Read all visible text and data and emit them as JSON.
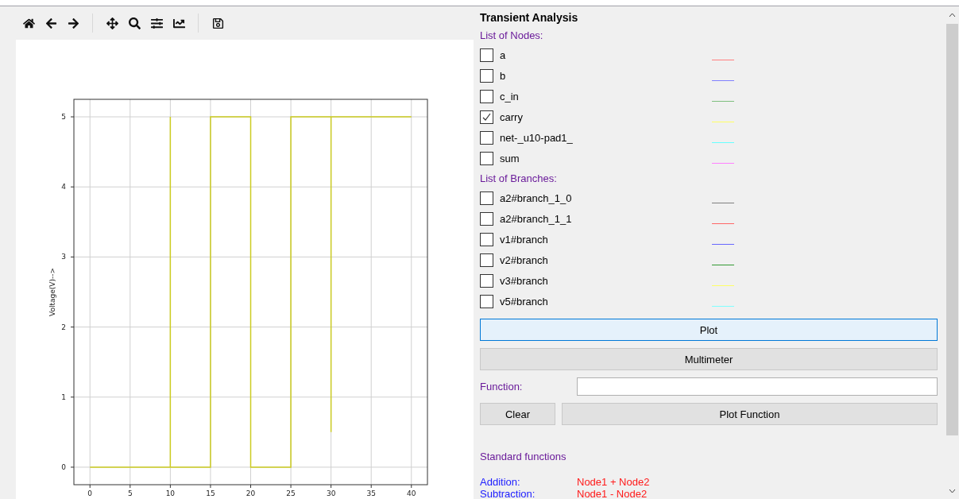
{
  "plot": {
    "chart_data": {
      "type": "line",
      "grid": true,
      "ylabel": "Voltage(V)-->",
      "xlim": [
        -2,
        42
      ],
      "ylim": [
        -0.25,
        5.25
      ],
      "xticks": [
        0,
        5,
        10,
        15,
        20,
        25,
        30,
        35,
        40
      ],
      "yticks": [
        0,
        1,
        2,
        3,
        4,
        5
      ],
      "x": [
        0,
        10,
        10,
        10,
        15,
        15,
        20,
        20,
        25,
        25,
        30,
        30,
        30,
        40
      ],
      "series": [
        {
          "color": "#cccc22",
          "values": [
            0,
            0,
            5,
            0,
            0,
            5,
            5,
            0,
            0,
            5,
            5,
            0.5,
            5,
            5
          ]
        }
      ]
    }
  },
  "panel": {
    "title": "Transient Analysis",
    "nodes_heading": "List of Nodes:",
    "nodes": [
      {
        "label": "a",
        "checked": false,
        "color": "#ff7f7f"
      },
      {
        "label": "b",
        "checked": false,
        "color": "#8080ff"
      },
      {
        "label": "c_in",
        "checked": false,
        "color": "#7fbf7f"
      },
      {
        "label": "carry",
        "checked": true,
        "color": "#ffff66"
      },
      {
        "label": "net-_u10-pad1_",
        "checked": false,
        "color": "#66ffff"
      },
      {
        "label": "sum",
        "checked": false,
        "color": "#ff80ff"
      }
    ],
    "branches_heading": "List of Branches:",
    "branches": [
      {
        "label": "a2#branch_1_0",
        "checked": false,
        "color": "#808080"
      },
      {
        "label": "a2#branch_1_1",
        "checked": false,
        "color": "#ff6666"
      },
      {
        "label": "v1#branch",
        "checked": false,
        "color": "#6666ff"
      },
      {
        "label": "v2#branch",
        "checked": false,
        "color": "#339933"
      },
      {
        "label": "v3#branch",
        "checked": false,
        "color": "#ffff66"
      },
      {
        "label": "v5#branch",
        "checked": false,
        "color": "#80ffff"
      }
    ],
    "plot_button": {
      "label": "Plot",
      "highlighted": true
    },
    "multimeter_button": {
      "label": "Multimeter",
      "highlighted": false
    },
    "function_label": "Function:",
    "clear_button": {
      "label": "Clear",
      "highlighted": false
    },
    "plot_function_button": {
      "label": "Plot Function",
      "highlighted": false
    },
    "standard_heading": "Standard functions",
    "standard_functions": [
      {
        "name": "Addition:",
        "expression": "Node1 + Node2"
      },
      {
        "name": "Subtraction:",
        "expression": "Node1 - Node2"
      }
    ]
  }
}
